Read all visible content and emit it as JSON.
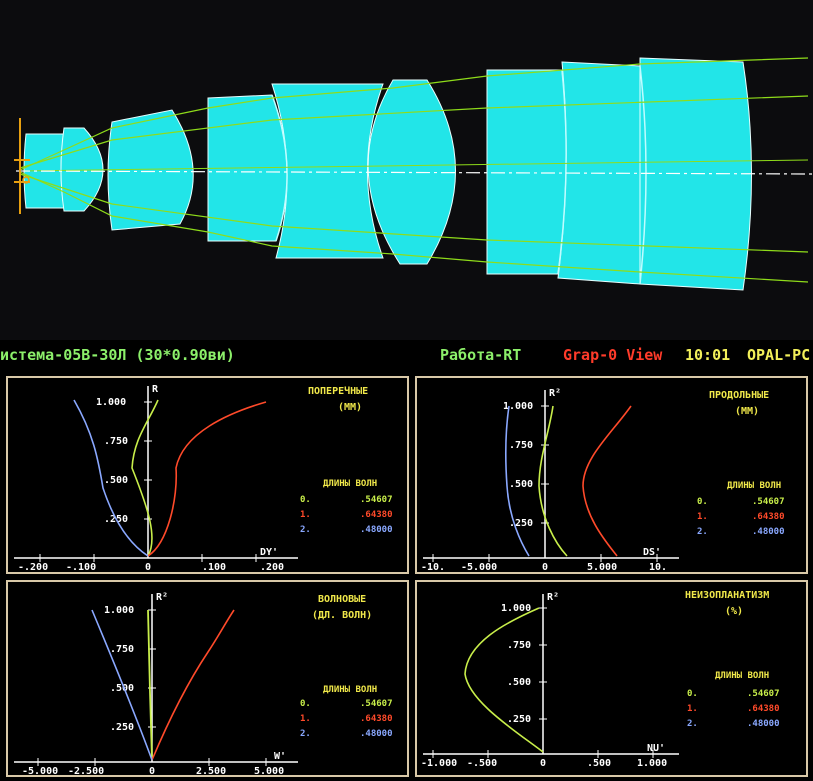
{
  "status_bar": {
    "system": "истема-05В-30Л (30*0.90ви)",
    "mode": "Работа-RT",
    "view": "Grap-0 View",
    "time": "10:01",
    "app": "OPAL-PC"
  },
  "colors": {
    "glass": "#22e5e8",
    "ray": "#8fdc1a",
    "status_green": "#8cf06a",
    "status_yellow": "#f2f05a",
    "status_red": "#ff3b2a",
    "panel_title": "#f0e84a",
    "wl0": "#c8ee4a",
    "wl1": "#ff4a2a",
    "wl2": "#8aa8ff",
    "axis": "#ffffff",
    "frame": "#d9c9a8"
  },
  "panels": {
    "transverse": {
      "title1": "ПОПЕРЕЧНЫЕ",
      "title2": "(ММ)",
      "y_axis": "R",
      "x_axis": "DY'",
      "y_ticks": [
        "1.000",
        ".750",
        ".500",
        ".250"
      ],
      "x_ticks": [
        "-.200",
        "-.100",
        "0",
        ".100",
        ".200"
      ]
    },
    "longitudinal": {
      "title1": "ПРОДОЛЬНЫЕ",
      "title2": "(ММ)",
      "y_axis": "R²",
      "x_axis": "DS'",
      "y_ticks": [
        "1.000",
        ".750",
        ".500",
        ".250"
      ],
      "x_ticks": [
        "-10.",
        "-5.000",
        "0",
        "5.000",
        "10."
      ]
    },
    "wave": {
      "title1": "ВОЛНОВЫЕ",
      "title2": "(ДЛ. ВОЛН)",
      "y_axis": "R²",
      "x_axis": "W'",
      "y_ticks": [
        "1.000",
        ".750",
        ".500",
        ".250"
      ],
      "x_ticks": [
        "-5.000",
        "-2.500",
        "0",
        "2.500",
        "5.000"
      ]
    },
    "nonisoplanatism": {
      "title1": "НЕИЗОПЛАНАТИЗМ",
      "title2": "(%)",
      "y_axis": "R²",
      "x_axis": "NU'",
      "y_ticks": [
        "1.000",
        ".750",
        ".500",
        ".250"
      ],
      "x_ticks": [
        "-1.000",
        "-.500",
        "0",
        ".500",
        "1.000"
      ]
    }
  },
  "wavelengths": {
    "header": "ДЛИНЫ ВОЛН",
    "items": [
      {
        "index": "0.",
        "value": ".54607"
      },
      {
        "index": "1.",
        "value": ".64380"
      },
      {
        "index": "2.",
        "value": ".48000"
      }
    ]
  }
}
